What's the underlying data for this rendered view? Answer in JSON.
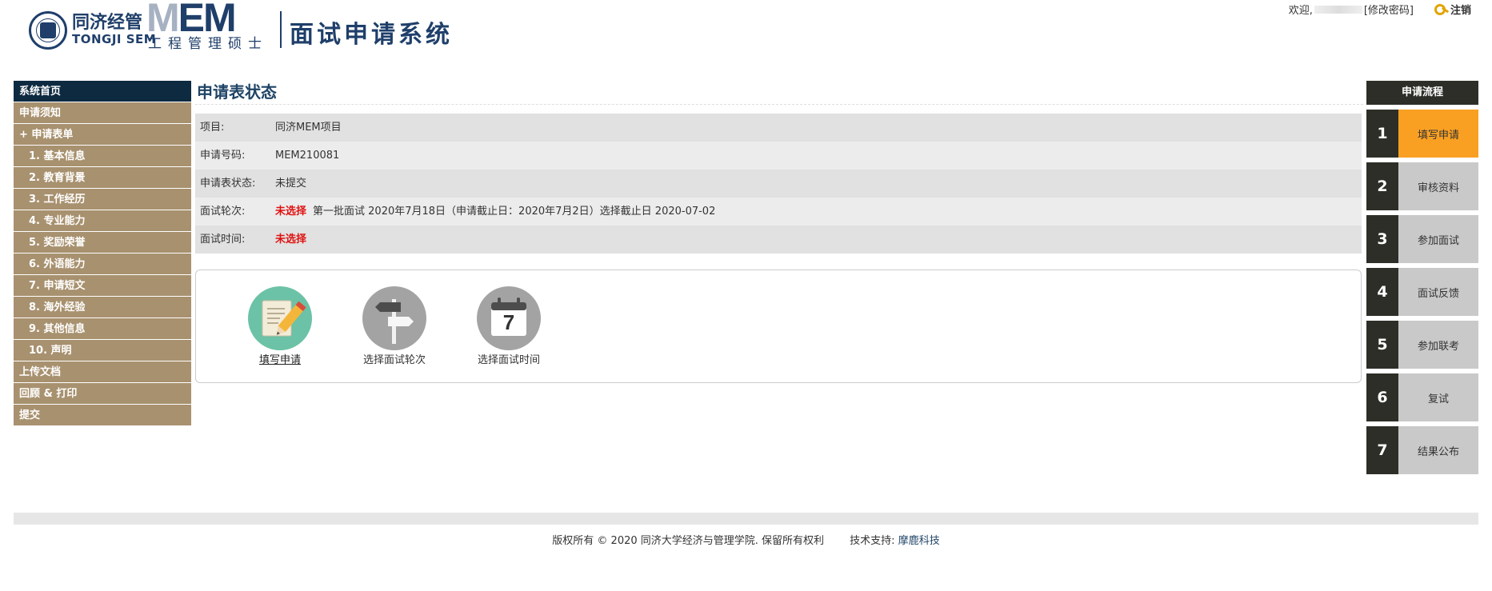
{
  "header": {
    "brand_cn": "同济经管",
    "brand_en": "TONGJI SEM",
    "mem_logo": "MEM",
    "mem_sub": "工程管理硕士",
    "system_title": "面试申请系统",
    "welcome": "欢迎,",
    "change_password": "[修改密码]",
    "logout": "注销",
    "logout_icon": "key-icon"
  },
  "sidebar": {
    "items": [
      {
        "label": "系统首页",
        "active": true
      },
      {
        "label": "申请须知"
      },
      {
        "label": "+ 申请表单"
      },
      {
        "label": "1. 基本信息"
      },
      {
        "label": "2. 教育背景"
      },
      {
        "label": "3. 工作经历"
      },
      {
        "label": "4. 专业能力"
      },
      {
        "label": "5. 奖励荣誉"
      },
      {
        "label": "6. 外语能力"
      },
      {
        "label": "7. 申请短文"
      },
      {
        "label": "8. 海外经验"
      },
      {
        "label": "9. 其他信息"
      },
      {
        "label": "10. 声明"
      },
      {
        "label": "上传文档"
      },
      {
        "label": "回顾 & 打印"
      },
      {
        "label": "提交"
      }
    ]
  },
  "main": {
    "title": "申请表状态",
    "rows": [
      {
        "label": "项目:",
        "value": "同济MEM项目"
      },
      {
        "label": "申请号码:",
        "value": "MEM210081"
      },
      {
        "label": "申请表状态:",
        "value": "未提交"
      },
      {
        "label": "面试轮次:",
        "status": "未选择",
        "value": "第一批面试 2020年7月18日（申请截止日：2020年7月2日）选择截止日  2020-07-02"
      },
      {
        "label": "面试时间:",
        "status": "未选择",
        "value": ""
      }
    ],
    "actions": [
      {
        "label": "填写申请",
        "icon": "pencil-form-icon"
      },
      {
        "label": "选择面试轮次",
        "icon": "signpost-icon"
      },
      {
        "label": "选择面试时间",
        "icon": "calendar-icon",
        "calendar_day": "7"
      }
    ]
  },
  "flow": {
    "title": "申请流程",
    "steps": [
      {
        "num": "1",
        "label": "填写申请",
        "current": true
      },
      {
        "num": "2",
        "label": "审核资料"
      },
      {
        "num": "3",
        "label": "参加面试"
      },
      {
        "num": "4",
        "label": "面试反馈"
      },
      {
        "num": "5",
        "label": "参加联考"
      },
      {
        "num": "6",
        "label": "复试"
      },
      {
        "num": "7",
        "label": "结果公布"
      }
    ]
  },
  "footer": {
    "copyright": "版权所有 © 2020 同济大学经济与管理学院. 保留所有权利",
    "tech_support": "技术支持:",
    "company": "摩鹿科技"
  },
  "colors": {
    "sidebar_bg": "#a8916f",
    "sidebar_active": "#0d2a40",
    "flow_current": "#f9a023",
    "flow_dark": "#2e2e28",
    "status_red": "#e01010",
    "brand_blue": "#1f3f6a"
  }
}
